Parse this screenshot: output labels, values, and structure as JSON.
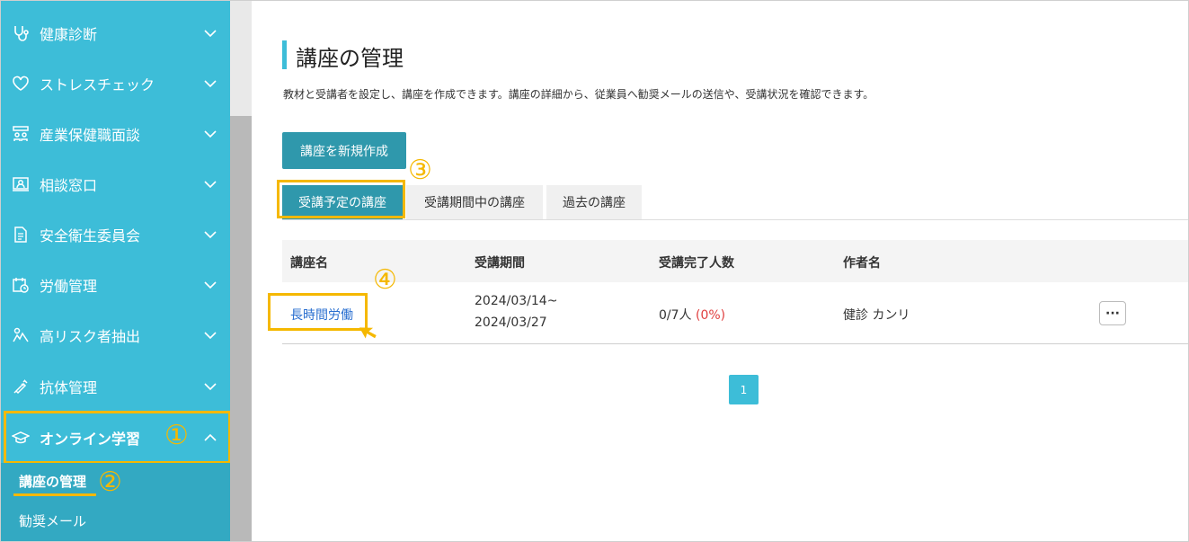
{
  "sidebar": {
    "items": [
      {
        "label": "健康診断",
        "icon": "stethoscope-icon"
      },
      {
        "label": "ストレスチェック",
        "icon": "heart-icon"
      },
      {
        "label": "産業保健職面談",
        "icon": "interview-icon"
      },
      {
        "label": "相談窓口",
        "icon": "consultation-icon"
      },
      {
        "label": "安全衛生委員会",
        "icon": "document-icon"
      },
      {
        "label": "労働管理",
        "icon": "calendar-clock-icon"
      },
      {
        "label": "高リスク者抽出",
        "icon": "risk-person-icon"
      },
      {
        "label": "抗体管理",
        "icon": "syringe-icon"
      },
      {
        "label": "オンライン学習",
        "icon": "graduation-cap-icon"
      }
    ],
    "sub_items": [
      {
        "label": "講座の管理"
      },
      {
        "label": "勧奨メール"
      }
    ]
  },
  "annotations": {
    "one": "①",
    "two": "②",
    "three": "③",
    "four": "④"
  },
  "main": {
    "title": "講座の管理",
    "description": "教材と受講者を設定し、講座を作成できます。講座の詳細から、従業員へ勧奨メールの送信や、受講状況を確認できます。",
    "create_button": "講座を新規作成",
    "tabs": [
      {
        "label": "受講予定の講座"
      },
      {
        "label": "受講期間中の講座"
      },
      {
        "label": "過去の講座"
      }
    ],
    "table": {
      "headers": [
        "講座名",
        "受講期間",
        "受講完了人数",
        "作者名"
      ],
      "rows": [
        {
          "name": "長時間労働",
          "period_start": "2024/03/14~",
          "period_end": "2024/03/27",
          "completed": "0/7人",
          "percent": "(0%)",
          "author": "健診 カンリ",
          "more": "···"
        }
      ]
    },
    "pagination": {
      "current": "1"
    }
  },
  "colors": {
    "accent": "#3dbdd8",
    "button": "#2f98ac",
    "highlight": "#f5b800",
    "link": "#2a6fd0",
    "percent": "#e04040"
  }
}
